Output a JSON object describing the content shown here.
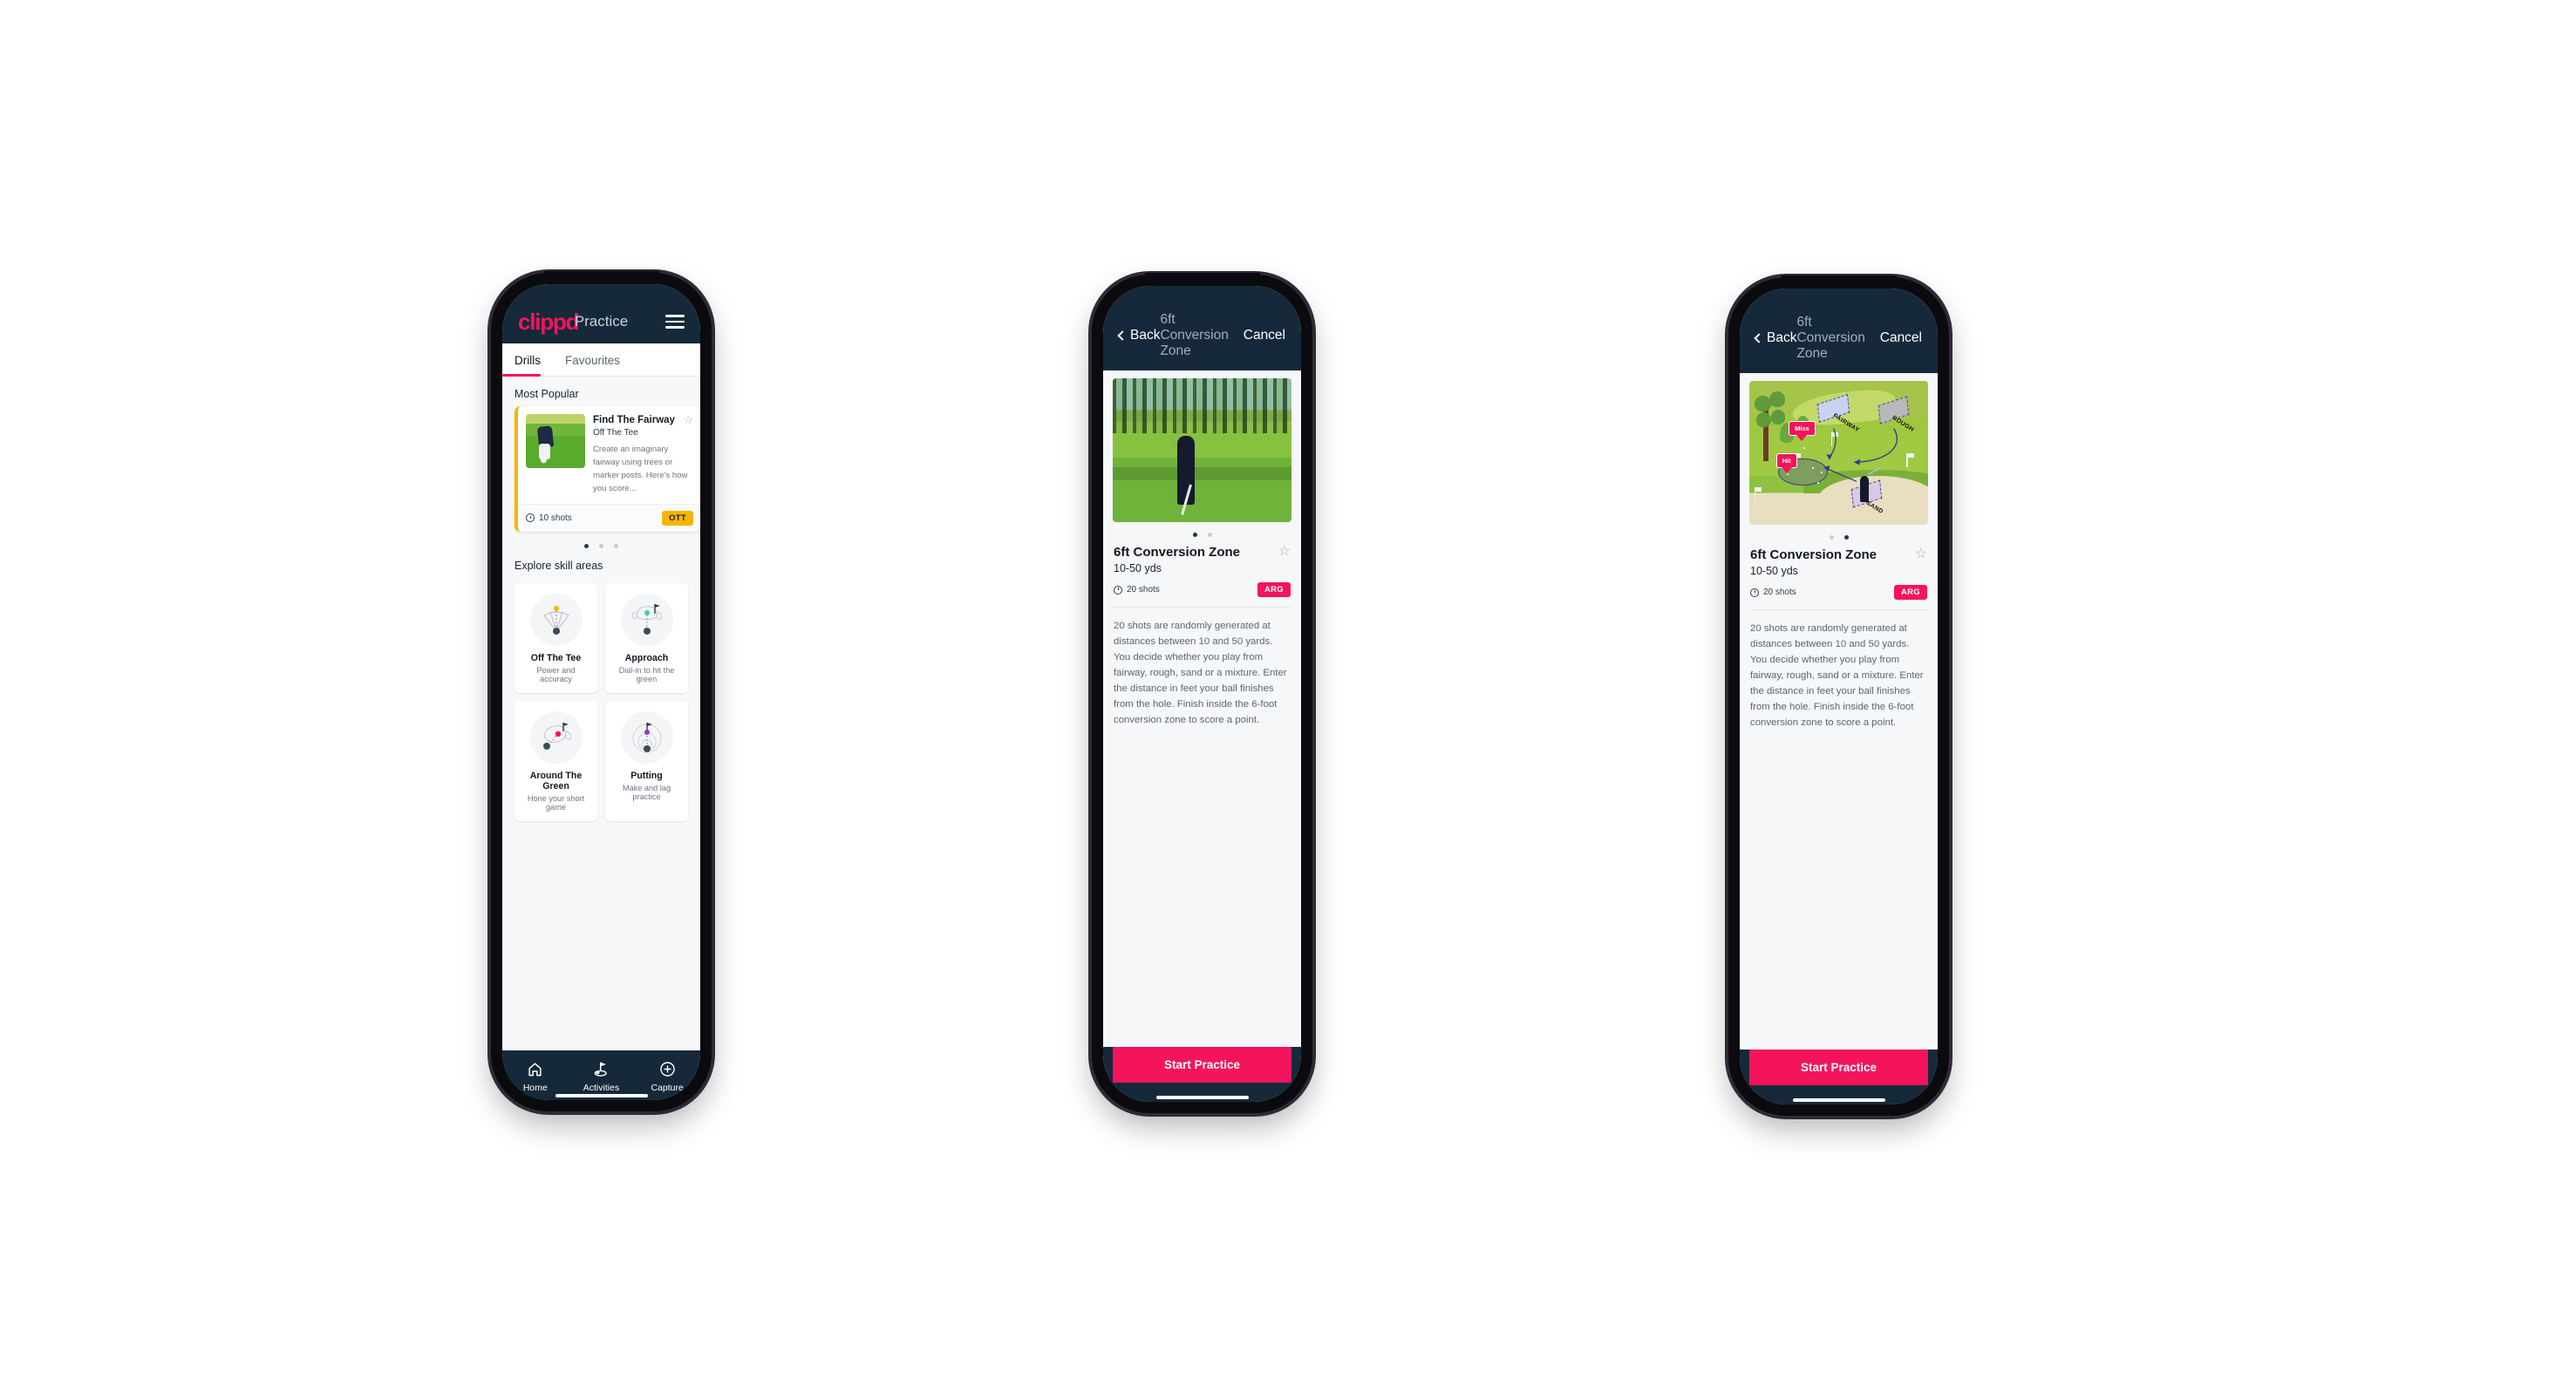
{
  "brand": {
    "name": "clippd",
    "accent": "#f4145b",
    "header_bg": "#15293a"
  },
  "phone1": {
    "appbar": {
      "logo": "clippd",
      "title": "Practice",
      "menu_icon": "hamburger-icon"
    },
    "tabs": [
      {
        "label": "Drills",
        "active": true
      },
      {
        "label": "Favourites",
        "active": false
      }
    ],
    "most_popular": {
      "section_label": "Most Popular",
      "card": {
        "title": "Find The Fairway",
        "subtitle": "Off The Tee",
        "description": "Create an imaginary fairway using trees or marker posts. Here's how you score...",
        "shots": "10 shots",
        "badge": "OTT",
        "badge_color": "#f7b500",
        "accent_bar": "#f7b500",
        "favourite_icon": "star-outline-icon"
      },
      "next_card_accent": "#3de0c8",
      "carousel_dots": 3,
      "carousel_active": 0
    },
    "explore": {
      "section_label": "Explore skill areas",
      "skills": [
        {
          "name": "Off The Tee",
          "desc": "Power and accuracy",
          "icon": "tee-fan-icon",
          "dot_color": "#f7b500"
        },
        {
          "name": "Approach",
          "desc": "Dial-in to hit the green",
          "icon": "approach-green-icon",
          "dot_color": "#2fd9b6"
        },
        {
          "name": "Around The Green",
          "desc": "Hone your short game",
          "icon": "around-green-icon",
          "dot_color": "#f4145b"
        },
        {
          "name": "Putting",
          "desc": "Make and lag practice",
          "icon": "putting-rings-icon",
          "dot_color": "#9b32c9"
        }
      ]
    },
    "bottom_nav": [
      {
        "label": "Home",
        "icon": "home-icon",
        "active": false
      },
      {
        "label": "Activities",
        "icon": "golf-flag-icon",
        "active": true
      },
      {
        "label": "Capture",
        "icon": "plus-circle-icon",
        "active": false
      }
    ]
  },
  "phone2": {
    "navbar": {
      "back": "Back",
      "title": "6ft Conversion Zone",
      "cancel": "Cancel",
      "back_icon": "chevron-left-icon"
    },
    "hero": {
      "type": "photo",
      "alt": "golfer chipping on fairway with pine trees"
    },
    "carousel_dots": 2,
    "carousel_active": 0,
    "detail": {
      "title": "6ft Conversion Zone",
      "yards": "10-50 yds",
      "shots": "20 shots",
      "badge": "ARG",
      "badge_color": "#f4145b",
      "favourite_icon": "star-outline-icon",
      "description": "20 shots are randomly generated at distances between 10 and 50 yards. You decide whether you play from fairway, rough, sand or a mixture. Enter the distance in feet your ball finishes from the hole. Finish inside the 6-foot conversion zone to score a point."
    },
    "cta": "Start Practice"
  },
  "phone3": {
    "navbar": {
      "back": "Back",
      "title": "6ft Conversion Zone",
      "cancel": "Cancel",
      "back_icon": "chevron-left-icon"
    },
    "hero": {
      "type": "illustration",
      "zones": [
        "FAIRWAY",
        "ROUGH",
        "SAND"
      ],
      "tags": [
        "Miss",
        "Hit"
      ]
    },
    "carousel_dots": 2,
    "carousel_active": 1,
    "detail": {
      "title": "6ft Conversion Zone",
      "yards": "10-50 yds",
      "shots": "20 shots",
      "badge": "ARG",
      "badge_color": "#f4145b",
      "favourite_icon": "star-outline-icon",
      "description": "20 shots are randomly generated at distances between 10 and 50 yards. You decide whether you play from fairway, rough, sand or a mixture. Enter the distance in feet your ball finishes from the hole. Finish inside the 6-foot conversion zone to score a point."
    },
    "cta": "Start Practice"
  }
}
